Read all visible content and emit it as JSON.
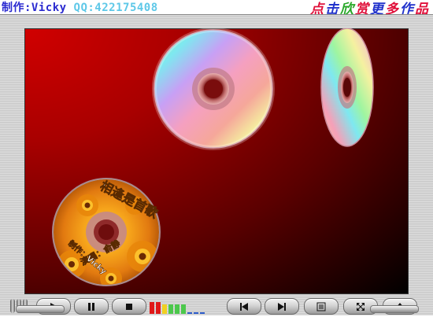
{
  "header": {
    "author_label": "制作:Vicky",
    "qq_label": "QQ:422175408",
    "click_text": [
      "点",
      "击",
      "欣",
      "赏",
      "更",
      "多",
      "作",
      "品"
    ],
    "click_colors": [
      "#e0103a",
      "#2233cc",
      "#28a828",
      "#e0103a",
      "#2233cc",
      "#e0103a",
      "#2233cc",
      "#e0103a"
    ]
  },
  "album_disc": {
    "song_title": "相逢是首歌",
    "singer_line": "演唱：俞静",
    "maker_line": "制作：Vicky"
  },
  "controls": {
    "play": "play-icon",
    "pause": "pause-icon",
    "stop": "stop-icon",
    "previous": "skip-back-icon",
    "next": "skip-forward-icon",
    "playlist": "list-icon",
    "fullscreen": "fullscreen-icon",
    "eject": "eject-icon",
    "volume_level": 0.55
  },
  "colors": {
    "screen_red": "#d10000",
    "screen_dark": "#000000",
    "author_blue": "#2a2ad0",
    "qq_cyan": "#5ec8e8"
  }
}
